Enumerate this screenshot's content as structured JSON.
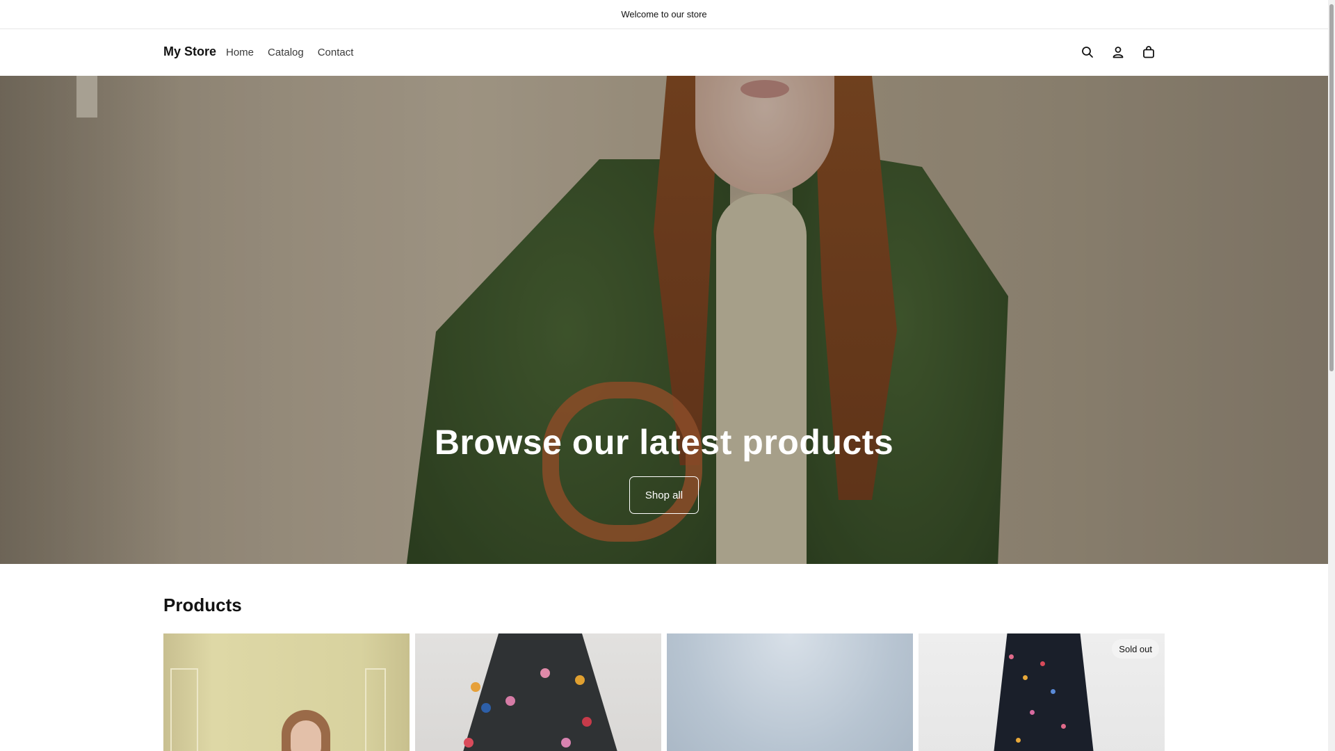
{
  "announcement": {
    "text": "Welcome to our store"
  },
  "header": {
    "logo": "My Store",
    "nav": [
      {
        "label": "Home"
      },
      {
        "label": "Catalog"
      },
      {
        "label": "Contact"
      }
    ],
    "icons": [
      "search-icon",
      "account-icon",
      "cart-icon"
    ]
  },
  "hero": {
    "headline": "Browse our latest products",
    "button_label": "Shop all"
  },
  "products": {
    "title": "Products",
    "items": [
      {
        "badge": ""
      },
      {
        "badge": ""
      },
      {
        "badge": ""
      },
      {
        "badge": "Sold out"
      }
    ]
  },
  "colors": {
    "text": "#121212",
    "nav_text": "#3a3a3a",
    "border": "#e6e6e6",
    "hero_green": "#3f572d",
    "hero_brown": "#8d5026"
  }
}
